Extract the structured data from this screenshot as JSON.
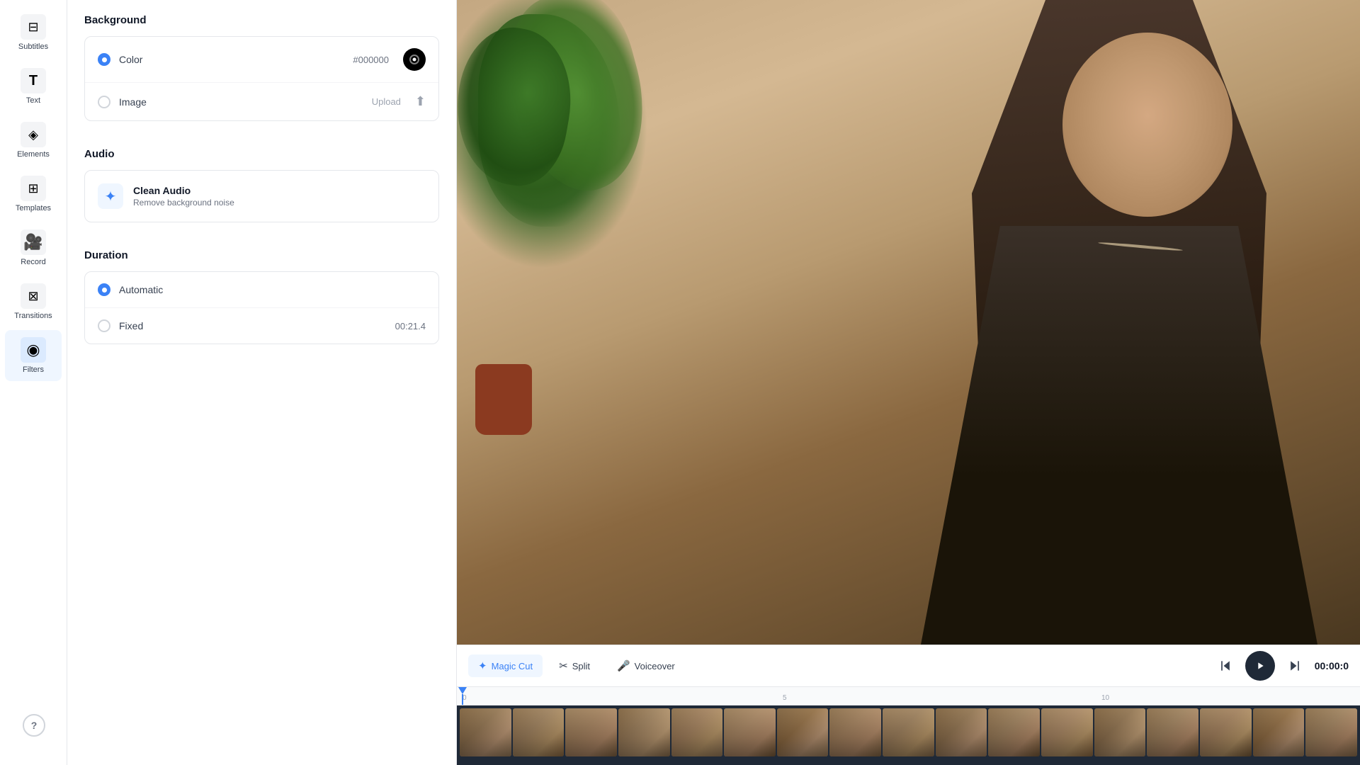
{
  "sidebar": {
    "items": [
      {
        "id": "subtitles",
        "label": "Subtitles",
        "icon": "⊟"
      },
      {
        "id": "text",
        "label": "Text",
        "icon": "T"
      },
      {
        "id": "elements",
        "label": "Elements",
        "icon": "◈"
      },
      {
        "id": "templates",
        "label": "Templates",
        "icon": "⊞"
      },
      {
        "id": "record",
        "label": "Record",
        "icon": "⬛"
      },
      {
        "id": "transitions",
        "label": "Transitions",
        "icon": "⊠"
      },
      {
        "id": "filters",
        "label": "Filters",
        "icon": "◉",
        "active": true
      }
    ],
    "help_label": "?"
  },
  "panel": {
    "background": {
      "section_title": "Background",
      "color_option": {
        "label": "Color",
        "value": "#000000",
        "checked": true
      },
      "image_option": {
        "label": "Image",
        "upload_label": "Upload",
        "checked": false
      }
    },
    "audio": {
      "section_title": "Audio",
      "clean_audio": {
        "title": "Clean Audio",
        "subtitle": "Remove background noise"
      }
    },
    "duration": {
      "section_title": "Duration",
      "automatic": {
        "label": "Automatic",
        "checked": true
      },
      "fixed": {
        "label": "Fixed",
        "time": "00:21.4",
        "checked": false
      }
    }
  },
  "timeline": {
    "magic_cut_label": "Magic Cut",
    "split_label": "Split",
    "voiceover_label": "Voiceover",
    "rewind_icon": "⏮",
    "play_icon": "▶",
    "forward_icon": "⏭",
    "timecode": "00:00:0",
    "ruler_marks": [
      "0",
      "5",
      "10"
    ],
    "ruler_positions": [
      "8px",
      "456px",
      "904px"
    ]
  }
}
